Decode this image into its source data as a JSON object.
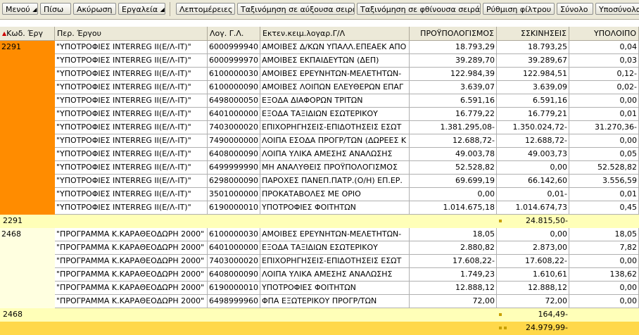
{
  "toolbar": {
    "menu": "Μενού",
    "back": "Πίσω",
    "cancel": "Ακύρωση",
    "tools": "Εργαλεία",
    "details": "Λεπτομέρειες",
    "sort_asc": "Ταξινόμηση σε αύξουσα σειρά",
    "sort_desc": "Ταξινόμηση σε φθίνουσα σειρά",
    "filter": "Ρύθμιση φίλτρου",
    "total": "Σύνολο",
    "subtotal": "Υποσύνολα"
  },
  "columns": {
    "code": "Κωδ. Έργ",
    "descr": "Περ. Έργου",
    "acct": "Λογ. Γ.Λ.",
    "acct_text": "Εκτεν.κειμ.λογαρ.Γ/Λ",
    "budget": "ΠΡΟΫΠΟΛΟΓΙΣΜΟΣ",
    "movements": "ΣΚΙΝΗΣΕΙΣ",
    "remaining": "ΥΠΟΛΟΙΠΟ"
  },
  "groups": [
    {
      "code": "2291",
      "rows": [
        [
          "\"ΥΠΟΤΡΟΦΙΕΣ INTERREG II(Ε/Λ-ΙΤ)\"",
          "6000999940",
          "ΑΜΟΙΒΕΣ Δ/ΚΩΝ ΥΠΑΛΛ.ΕΠΕΑΕΚ ΑΠΟ",
          "18.793,29",
          "18.793,25",
          "0,04"
        ],
        [
          "\"ΥΠΟΤΡΟΦΙΕΣ INTERREG II(Ε/Λ-ΙΤ)\"",
          "6000999970",
          "ΑΜΟΙΒΕΣ ΕΚΠΑΙΔΕΥΤΩΝ (ΔΕΠ)",
          "39.289,70",
          "39.289,67",
          "0,03"
        ],
        [
          "\"ΥΠΟΤΡΟΦΙΕΣ INTERREG II(Ε/Λ-ΙΤ)\"",
          "6100000030",
          "ΑΜΟΙΒΕΣ ΕΡΕΥΝΗΤΩΝ-ΜΕΛΕΤΗΤΩΝ-",
          "122.984,39",
          "122.984,51",
          "0,12-"
        ],
        [
          "\"ΥΠΟΤΡΟΦΙΕΣ INTERREG II(Ε/Λ-ΙΤ)\"",
          "6100000090",
          "ΑΜΟΙΒΕΣ ΛΟΙΠΩΝ ΕΛΕΥΘΕΡΩΝ ΕΠΑΓ",
          "3.639,07",
          "3.639,09",
          "0,02-"
        ],
        [
          "\"ΥΠΟΤΡΟΦΙΕΣ INTERREG II(Ε/Λ-ΙΤ)\"",
          "6498000050",
          "ΕΞΟΔΑ ΔΙΑΦΟΡΩΝ ΤΡΙΤΩΝ",
          "6.591,16",
          "6.591,16",
          "0,00"
        ],
        [
          "\"ΥΠΟΤΡΟΦΙΕΣ INTERREG II(Ε/Λ-ΙΤ)\"",
          "6401000000",
          "ΕΞΟΔΑ ΤΑΞΙΔΙΩΝ ΕΣΩΤΕΡΙΚΟΥ",
          "16.779,22",
          "16.779,21",
          "0,01"
        ],
        [
          "\"ΥΠΟΤΡΟΦΙΕΣ INTERREG II(Ε/Λ-ΙΤ)\"",
          "7403000020",
          "ΕΠΙΧΟΡΗΓΗΣΕΙΣ-ΕΠΙΔΟΤΗΣΕΙΣ ΕΣΩΤ",
          "1.381.295,08-",
          "1.350.024,72-",
          "31.270,36-"
        ],
        [
          "\"ΥΠΟΤΡΟΦΙΕΣ INTERREG II(Ε/Λ-ΙΤ)\"",
          "7490000000",
          "ΛΟΙΠΑ ΕΣΟΔΑ ΠΡΟΓΡ/ΤΩΝ (ΔΩΡΕΕΣ Κ",
          "12.688,72-",
          "12.688,72-",
          "0,00"
        ],
        [
          "\"ΥΠΟΤΡΟΦΙΕΣ INTERREG II(Ε/Λ-ΙΤ)\"",
          "6408000090",
          "ΛΟΙΠΑ ΥΛΙΚΑ ΑΜΕΣΗΣ ΑΝΑΛΩΣΗΣ",
          "49.003,78",
          "49.003,73",
          "0,05"
        ],
        [
          "\"ΥΠΟΤΡΟΦΙΕΣ INTERREG II(Ε/Λ-ΙΤ)\"",
          "6499999990",
          "ΜΗ ΑΝΑΛΥΘΕΙΣ ΠΡΟΫΠΟΛΟΓΙΣΜΟΣ",
          "52.528,82",
          "0,00",
          "52.528,82"
        ],
        [
          "\"ΥΠΟΤΡΟΦΙΕΣ INTERREG II(Ε/Λ-ΙΤ)\"",
          "6298000090",
          "ΠΑΡΟΧΕΣ ΠΑΝΕΠ.ΠΑΤΡ.(Ο/Η) ΕΠ.ΕΡ.",
          "69.699,19",
          "66.142,60",
          "3.556,59"
        ],
        [
          "\"ΥΠΟΤΡΟΦΙΕΣ INTERREG II(Ε/Λ-ΙΤ)\"",
          "3501000000",
          "ΠΡΟΚΑΤΑΒΟΛΕΣ ΜΕ ΟΡΙΟ",
          "0,00",
          "0,01-",
          "0,01"
        ],
        [
          "\"ΥΠΟΤΡΟΦΙΕΣ INTERREG II(Ε/Λ-ΙΤ)\"",
          "6190000010",
          "ΥΠΟΤΡΟΦΙΕΣ ΦΟΙΤΗΤΩΝ",
          "1.014.675,18",
          "1.014.674,73",
          "0,45"
        ]
      ],
      "subtotal": "24.815,50-"
    },
    {
      "code": "2468",
      "rows": [
        [
          "\"ΠΡΟΓΡΑΜΜΑ Κ.ΚΑΡΑΘΕΟΔΩΡΗ 2000\"",
          "6100000030",
          "ΑΜΟΙΒΕΣ ΕΡΕΥΝΗΤΩΝ-ΜΕΛΕΤΗΤΩΝ-",
          "18,05",
          "0,00",
          "18,05"
        ],
        [
          "\"ΠΡΟΓΡΑΜΜΑ Κ.ΚΑΡΑΘΕΟΔΩΡΗ 2000\"",
          "6401000000",
          "ΕΞΟΔΑ ΤΑΞΙΔΙΩΝ ΕΣΩΤΕΡΙΚΟΥ",
          "2.880,82",
          "2.873,00",
          "7,82"
        ],
        [
          "\"ΠΡΟΓΡΑΜΜΑ Κ.ΚΑΡΑΘΕΟΔΩΡΗ 2000\"",
          "7403000020",
          "ΕΠΙΧΟΡΗΓΗΣΕΙΣ-ΕΠΙΔΟΤΗΣΕΙΣ ΕΣΩΤ",
          "17.608,22-",
          "17.608,22-",
          "0,00"
        ],
        [
          "\"ΠΡΟΓΡΑΜΜΑ Κ.ΚΑΡΑΘΕΟΔΩΡΗ 2000\"",
          "6408000090",
          "ΛΟΙΠΑ ΥΛΙΚΑ ΑΜΕΣΗΣ ΑΝΑΛΩΣΗΣ",
          "1.749,23",
          "1.610,61",
          "138,62"
        ],
        [
          "\"ΠΡΟΓΡΑΜΜΑ Κ.ΚΑΡΑΘΕΟΔΩΡΗ 2000\"",
          "6190000010",
          "ΥΠΟΤΡΟΦΙΕΣ ΦΟΙΤΗΤΩΝ",
          "12.888,12",
          "12.888,12",
          "0,00"
        ],
        [
          "\"ΠΡΟΓΡΑΜΜΑ Κ.ΚΑΡΑΘΕΟΔΩΡΗ 2000\"",
          "6498999960",
          "ΦΠΑ ΕΞΩΤΕΡΙΚΟΥ ΠΡΟΓΡ/ΤΩΝ",
          "72,00",
          "72,00",
          "0,00"
        ]
      ],
      "subtotal": "164,49-"
    }
  ],
  "grand_total": "24.979,99-",
  "colors": {
    "selected": "#ff8c00",
    "subtotal_row": "#ffffb8",
    "grand_total_row": "#ffd84a"
  }
}
